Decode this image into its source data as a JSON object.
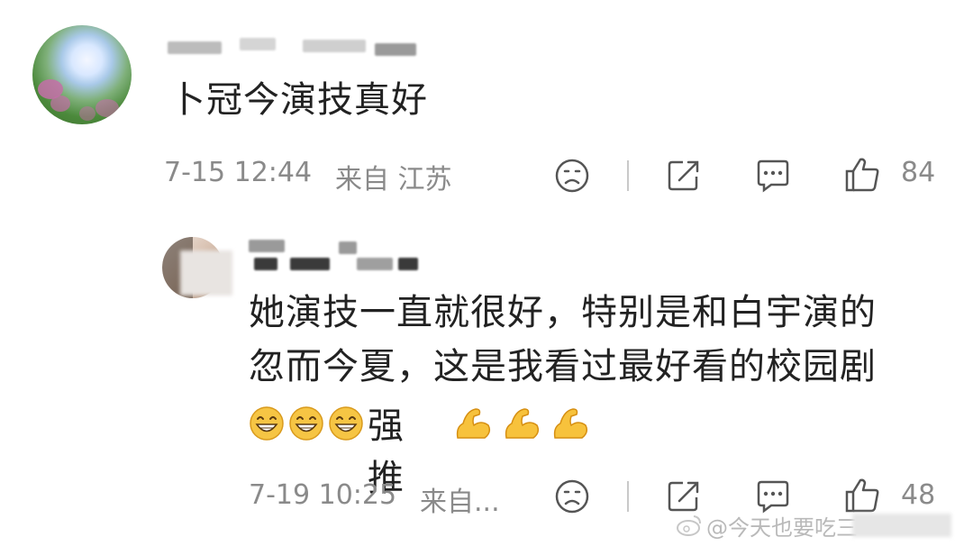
{
  "comments": [
    {
      "text": "卜冠今演技真好",
      "time": "7-15 12:44",
      "location": "来自 江苏",
      "likes": "84"
    },
    {
      "text_line1": "她演技一直就很好，特别是和白宇演的",
      "text_line2": "忽而今夏，这是我看过最好看的校园剧",
      "text_tail": "强推",
      "time": "7-19 10:25",
      "location": "来自...",
      "likes": "48"
    }
  ],
  "icons": [
    "sad-face-icon",
    "share-icon",
    "comment-icon",
    "like-icon",
    "grin-emoji-icon",
    "flex-arm-emoji-icon",
    "weibo-logo-icon"
  ],
  "watermark": "@今天也要吃三"
}
